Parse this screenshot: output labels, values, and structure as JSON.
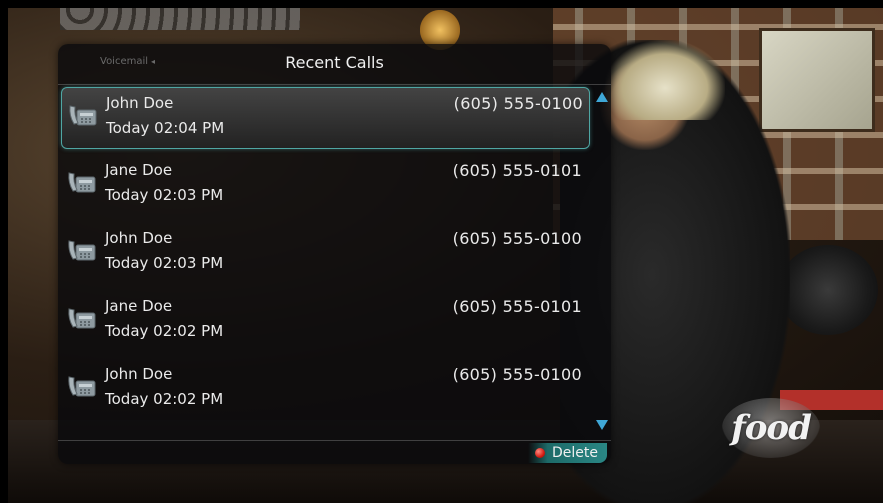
{
  "header": {
    "voicemail_tab": "Voicemail",
    "voicemail_arrow": "◂",
    "title": "Recent Calls"
  },
  "calls": [
    {
      "name": "John Doe",
      "time": "Today 02:04 PM",
      "number": "(605) 555-0100",
      "selected": true
    },
    {
      "name": "Jane Doe",
      "time": "Today 02:03 PM",
      "number": "(605) 555-0101",
      "selected": false
    },
    {
      "name": "John Doe",
      "time": "Today 02:03 PM",
      "number": "(605) 555-0100",
      "selected": false
    },
    {
      "name": "Jane Doe",
      "time": "Today 02:02 PM",
      "number": "(605) 555-0101",
      "selected": false
    },
    {
      "name": "John Doe",
      "time": "Today 02:02 PM",
      "number": "(605) 555-0100",
      "selected": false
    }
  ],
  "footer": {
    "delete_label": "Delete"
  },
  "logo": {
    "text": "food"
  },
  "colors": {
    "selection_border": "#4fa6a3",
    "scroll_arrow": "#3fa7d6",
    "delete_button": "#2a8785",
    "red_button": "#d31b12"
  },
  "icons": {
    "call_row": "telephone-icon",
    "scroll_up": "scroll-up-icon",
    "scroll_down": "scroll-down-icon",
    "delete": "red-button-icon"
  }
}
